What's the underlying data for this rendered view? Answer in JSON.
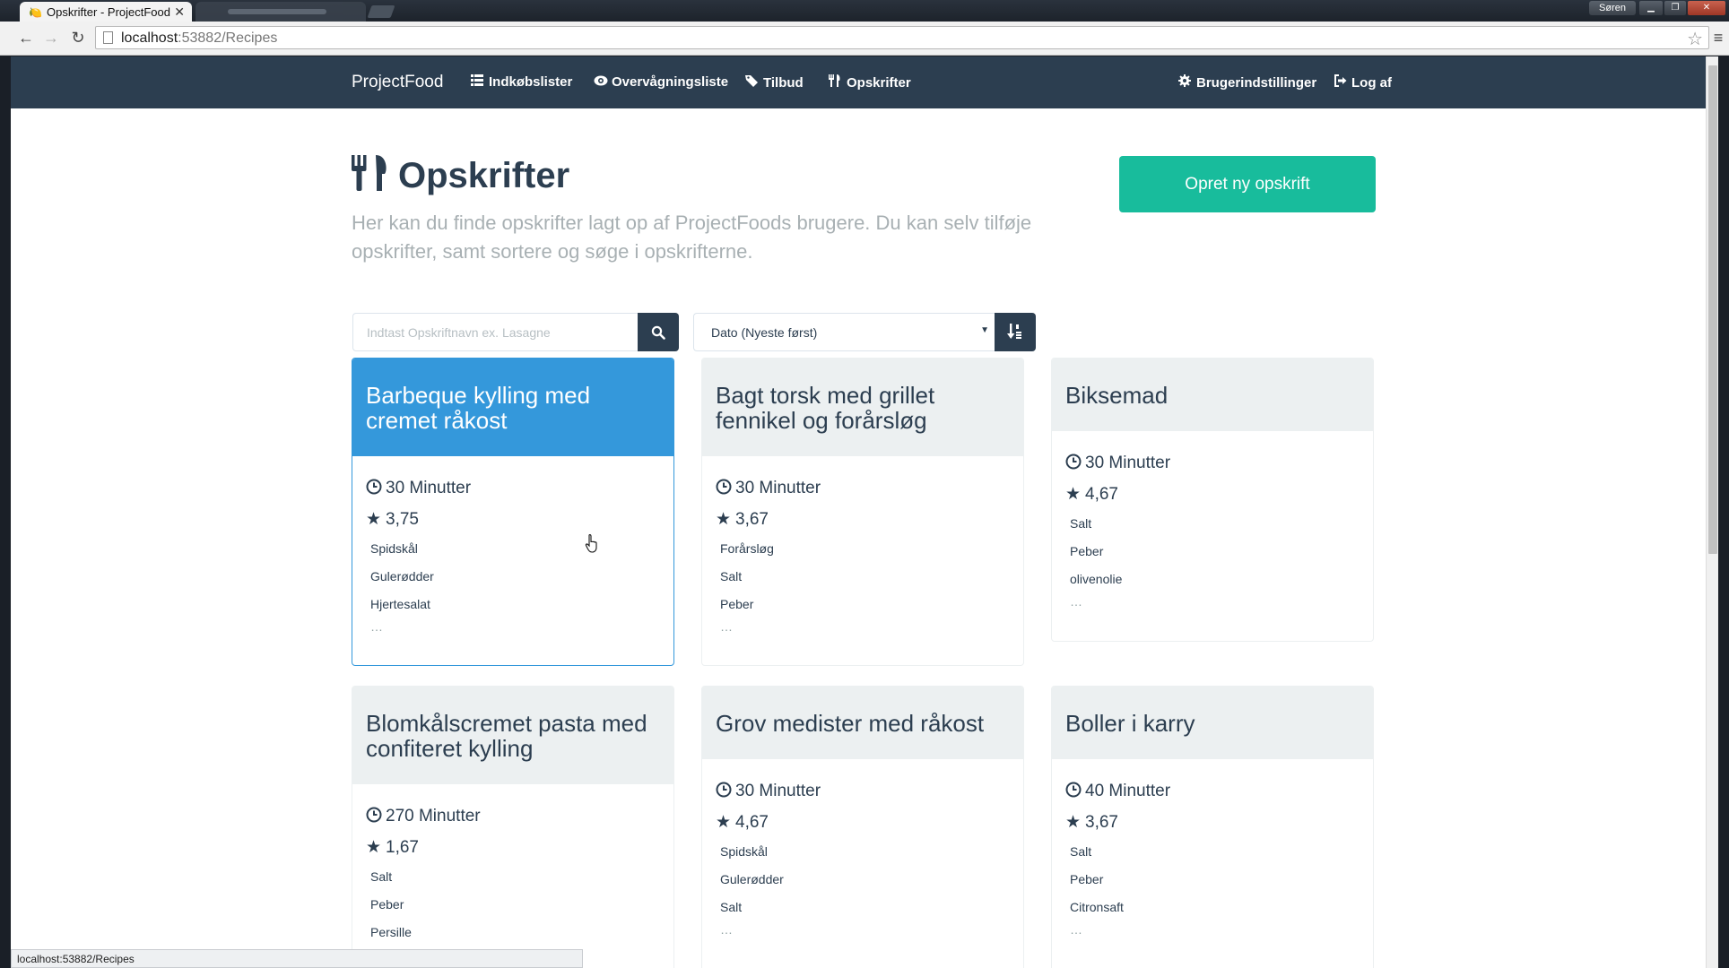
{
  "browser": {
    "tab_title": "Opskrifter - ProjectFood",
    "tab_close": "✕",
    "user_button": "Søren",
    "url_host": "localhost",
    "url_rest": ":53882/Recipes",
    "status_url": "localhost:53882/Recipes"
  },
  "navbar": {
    "brand": "ProjectFood",
    "items": [
      {
        "label": "Indkøbslister",
        "icon": "list-icon"
      },
      {
        "label": "Overvågningsliste",
        "icon": "eye-icon"
      },
      {
        "label": "Tilbud",
        "icon": "tag-icon"
      },
      {
        "label": "Opskrifter",
        "icon": "cutlery-icon"
      }
    ],
    "right_items": [
      {
        "label": "Brugerindstillinger",
        "icon": "gear-icon"
      },
      {
        "label": "Log af",
        "icon": "logout-icon"
      }
    ]
  },
  "header": {
    "title": "Opskrifter",
    "lead": "Her kan du finde opskrifter lagt op af ProjectFoods brugere. Du kan selv tilføje opskrifter, samt sortere og søge i opskrifterne.",
    "create_button": "Opret ny opskrift"
  },
  "search": {
    "placeholder": "Indtast Opskriftnavn ex. Lasagne",
    "sort_value": "Dato (Nyeste først)"
  },
  "recipes": [
    {
      "title": "Barbeque kylling med cremet råkost",
      "time": "30 Minutter",
      "rating": "3,75",
      "ingredients": [
        "Spidskål",
        "Gulerødder",
        "Hjertesalat"
      ],
      "more": "…"
    },
    {
      "title": "Bagt torsk med grillet fennikel og forårsløg",
      "time": "30 Minutter",
      "rating": "3,67",
      "ingredients": [
        "Forårsløg",
        "Salt",
        "Peber"
      ],
      "more": "…"
    },
    {
      "title": "Biksemad",
      "time": "30 Minutter",
      "rating": "4,67",
      "ingredients": [
        "Salt",
        "Peber",
        "olivenolie"
      ],
      "more": "…"
    },
    {
      "title": "Blomkålscremet pasta med confiteret kylling",
      "time": "270 Minutter",
      "rating": "1,67",
      "ingredients": [
        "Salt",
        "Peber",
        "Persille"
      ],
      "more": "…"
    },
    {
      "title": "Grov medister med råkost",
      "time": "30 Minutter",
      "rating": "4,67",
      "ingredients": [
        "Spidskål",
        "Gulerødder",
        "Salt"
      ],
      "more": "…"
    },
    {
      "title": "Boller i karry",
      "time": "40 Minutter",
      "rating": "3,67",
      "ingredients": [
        "Salt",
        "Peber",
        "Citronsaft"
      ],
      "more": "…"
    }
  ],
  "colors": {
    "navbar": "#2c3e50",
    "primary_accent": "#18bc9c",
    "active_card": "#3498db",
    "card_header": "#ecf0f1"
  }
}
